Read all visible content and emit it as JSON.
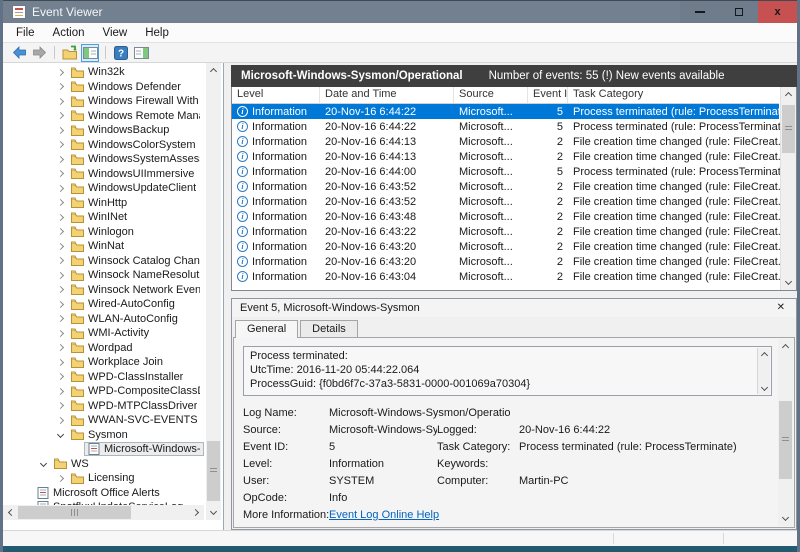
{
  "window": {
    "title": "Event Viewer"
  },
  "menu": {
    "items": [
      "File",
      "Action",
      "View",
      "Help"
    ]
  },
  "toolbar": {
    "buttons": [
      "back",
      "forward",
      "open-saved-log",
      "show-hide-console-tree",
      "help",
      "show-hide-action-pane"
    ]
  },
  "tree": {
    "items": [
      {
        "label": "Win32k",
        "level": 2,
        "chevron": "collapsed",
        "icon": "folder",
        "selected": false
      },
      {
        "label": "Windows Defender",
        "level": 2,
        "chevron": "collapsed",
        "icon": "folder",
        "selected": false
      },
      {
        "label": "Windows Firewall With Adv",
        "level": 2,
        "chevron": "collapsed",
        "icon": "folder",
        "selected": false
      },
      {
        "label": "Windows Remote Manager",
        "level": 2,
        "chevron": "collapsed",
        "icon": "folder",
        "selected": false
      },
      {
        "label": "WindowsBackup",
        "level": 2,
        "chevron": "collapsed",
        "icon": "folder",
        "selected": false
      },
      {
        "label": "WindowsColorSystem",
        "level": 2,
        "chevron": "collapsed",
        "icon": "folder",
        "selected": false
      },
      {
        "label": "WindowsSystemAssessmen",
        "level": 2,
        "chevron": "collapsed",
        "icon": "folder",
        "selected": false
      },
      {
        "label": "WindowsUIImmersive",
        "level": 2,
        "chevron": "collapsed",
        "icon": "folder",
        "selected": false
      },
      {
        "label": "WindowsUpdateClient",
        "level": 2,
        "chevron": "collapsed",
        "icon": "folder",
        "selected": false
      },
      {
        "label": "WinHttp",
        "level": 2,
        "chevron": "collapsed",
        "icon": "folder",
        "selected": false
      },
      {
        "label": "WinINet",
        "level": 2,
        "chevron": "collapsed",
        "icon": "folder",
        "selected": false
      },
      {
        "label": "Winlogon",
        "level": 2,
        "chevron": "collapsed",
        "icon": "folder",
        "selected": false
      },
      {
        "label": "WinNat",
        "level": 2,
        "chevron": "collapsed",
        "icon": "folder",
        "selected": false
      },
      {
        "label": "Winsock Catalog Change",
        "level": 2,
        "chevron": "collapsed",
        "icon": "folder",
        "selected": false
      },
      {
        "label": "Winsock NameResolution E",
        "level": 2,
        "chevron": "collapsed",
        "icon": "folder",
        "selected": false
      },
      {
        "label": "Winsock Network Event",
        "level": 2,
        "chevron": "collapsed",
        "icon": "folder",
        "selected": false
      },
      {
        "label": "Wired-AutoConfig",
        "level": 2,
        "chevron": "collapsed",
        "icon": "folder",
        "selected": false
      },
      {
        "label": "WLAN-AutoConfig",
        "level": 2,
        "chevron": "collapsed",
        "icon": "folder",
        "selected": false
      },
      {
        "label": "WMI-Activity",
        "level": 2,
        "chevron": "collapsed",
        "icon": "folder",
        "selected": false
      },
      {
        "label": "Wordpad",
        "level": 2,
        "chevron": "collapsed",
        "icon": "folder",
        "selected": false
      },
      {
        "label": "Workplace Join",
        "level": 2,
        "chevron": "collapsed",
        "icon": "folder",
        "selected": false
      },
      {
        "label": "WPD-ClassInstaller",
        "level": 2,
        "chevron": "collapsed",
        "icon": "folder",
        "selected": false
      },
      {
        "label": "WPD-CompositeClassDrive",
        "level": 2,
        "chevron": "collapsed",
        "icon": "folder",
        "selected": false
      },
      {
        "label": "WPD-MTPClassDriver",
        "level": 2,
        "chevron": "collapsed",
        "icon": "folder",
        "selected": false
      },
      {
        "label": "WWAN-SVC-EVENTS",
        "level": 2,
        "chevron": "collapsed",
        "icon": "folder",
        "selected": false
      },
      {
        "label": "Sysmon",
        "level": 2,
        "chevron": "expanded",
        "icon": "folder",
        "selected": false
      },
      {
        "label": "Microsoft-Windows-Sys",
        "level": 3,
        "chevron": "none",
        "icon": "log",
        "selected": true
      },
      {
        "label": "WS",
        "level": 1,
        "chevron": "expanded",
        "icon": "folder",
        "selected": false
      },
      {
        "label": "Licensing",
        "level": 2,
        "chevron": "collapsed",
        "icon": "folder",
        "selected": false
      },
      {
        "label": "Microsoft Office Alerts",
        "level": 0,
        "chevron": "none",
        "icon": "log",
        "selected": false
      },
      {
        "label": "SpotfluxUpdateServiceLog",
        "level": 0,
        "chevron": "none",
        "icon": "log",
        "selected": false
      }
    ]
  },
  "list": {
    "title": "Microsoft-Windows-Sysmon/Operational",
    "status": "Number of events: 55 (!) New events available",
    "columns": [
      "Level",
      "Date and Time",
      "Source",
      "Event ID",
      "Task Category"
    ],
    "rows": [
      {
        "level": "Information",
        "date_time": "20-Nov-16 6:44:22",
        "source": "Microsoft...",
        "event_id": "5",
        "task_category": "Process terminated (rule: ProcessTerminate)",
        "selected": true
      },
      {
        "level": "Information",
        "date_time": "20-Nov-16 6:44:22",
        "source": "Microsoft...",
        "event_id": "5",
        "task_category": "Process terminated (rule: ProcessTerminate)",
        "selected": false
      },
      {
        "level": "Information",
        "date_time": "20-Nov-16 6:44:13",
        "source": "Microsoft...",
        "event_id": "2",
        "task_category": "File creation time changed (rule: FileCreat...",
        "selected": false
      },
      {
        "level": "Information",
        "date_time": "20-Nov-16 6:44:13",
        "source": "Microsoft...",
        "event_id": "2",
        "task_category": "File creation time changed (rule: FileCreat...",
        "selected": false
      },
      {
        "level": "Information",
        "date_time": "20-Nov-16 6:44:00",
        "source": "Microsoft...",
        "event_id": "5",
        "task_category": "Process terminated (rule: ProcessTerminate)",
        "selected": false
      },
      {
        "level": "Information",
        "date_time": "20-Nov-16 6:43:52",
        "source": "Microsoft...",
        "event_id": "2",
        "task_category": "File creation time changed (rule: FileCreat...",
        "selected": false
      },
      {
        "level": "Information",
        "date_time": "20-Nov-16 6:43:52",
        "source": "Microsoft...",
        "event_id": "2",
        "task_category": "File creation time changed (rule: FileCreat...",
        "selected": false
      },
      {
        "level": "Information",
        "date_time": "20-Nov-16 6:43:48",
        "source": "Microsoft...",
        "event_id": "2",
        "task_category": "File creation time changed (rule: FileCreat...",
        "selected": false
      },
      {
        "level": "Information",
        "date_time": "20-Nov-16 6:43:22",
        "source": "Microsoft...",
        "event_id": "2",
        "task_category": "File creation time changed (rule: FileCreat...",
        "selected": false
      },
      {
        "level": "Information",
        "date_time": "20-Nov-16 6:43:20",
        "source": "Microsoft...",
        "event_id": "2",
        "task_category": "File creation time changed (rule: FileCreat...",
        "selected": false
      },
      {
        "level": "Information",
        "date_time": "20-Nov-16 6:43:20",
        "source": "Microsoft...",
        "event_id": "2",
        "task_category": "File creation time changed (rule: FileCreat...",
        "selected": false
      },
      {
        "level": "Information",
        "date_time": "20-Nov-16 6:43:04",
        "source": "Microsoft...",
        "event_id": "2",
        "task_category": "File creation time changed (rule: FileCreat...",
        "selected": false
      }
    ]
  },
  "detail": {
    "title": "Event 5, Microsoft-Windows-Sysmon",
    "tabs": [
      "General",
      "Details"
    ],
    "active_tab": "General",
    "message_lines": [
      "Process terminated:",
      "UtcTime: 2016-11-20 05:44:22.064",
      "ProcessGuid: {f0bd6f7c-37a3-5831-0000-001069a70304}"
    ],
    "fields": [
      {
        "l1": "Log Name:",
        "v1": "Microsoft-Windows-Sysmon/Operational",
        "l2": "",
        "v2": ""
      },
      {
        "l1": "Source:",
        "v1": "Microsoft-Windows-Sysmon",
        "l2": "Logged:",
        "v2": "20-Nov-16 6:44:22"
      },
      {
        "l1": "Event ID:",
        "v1": "5",
        "l2": "Task Category:",
        "v2": "Process terminated (rule: ProcessTerminate)"
      },
      {
        "l1": "Level:",
        "v1": "Information",
        "l2": "Keywords:",
        "v2": ""
      },
      {
        "l1": "User:",
        "v1": "SYSTEM",
        "l2": "Computer:",
        "v2": "Martin-PC"
      },
      {
        "l1": "OpCode:",
        "v1": "Info",
        "l2": "",
        "v2": ""
      },
      {
        "l1": "More Information:",
        "v1": "Event Log Online Help",
        "l2": "",
        "v2": "",
        "link": true
      }
    ]
  },
  "colors": {
    "titlebar": "#72808f",
    "close_button": "#c75050",
    "selection": "#0078d7",
    "header_bar": "#3f3f3f",
    "link": "#0563c1",
    "folder_icon": "#f3d273"
  }
}
